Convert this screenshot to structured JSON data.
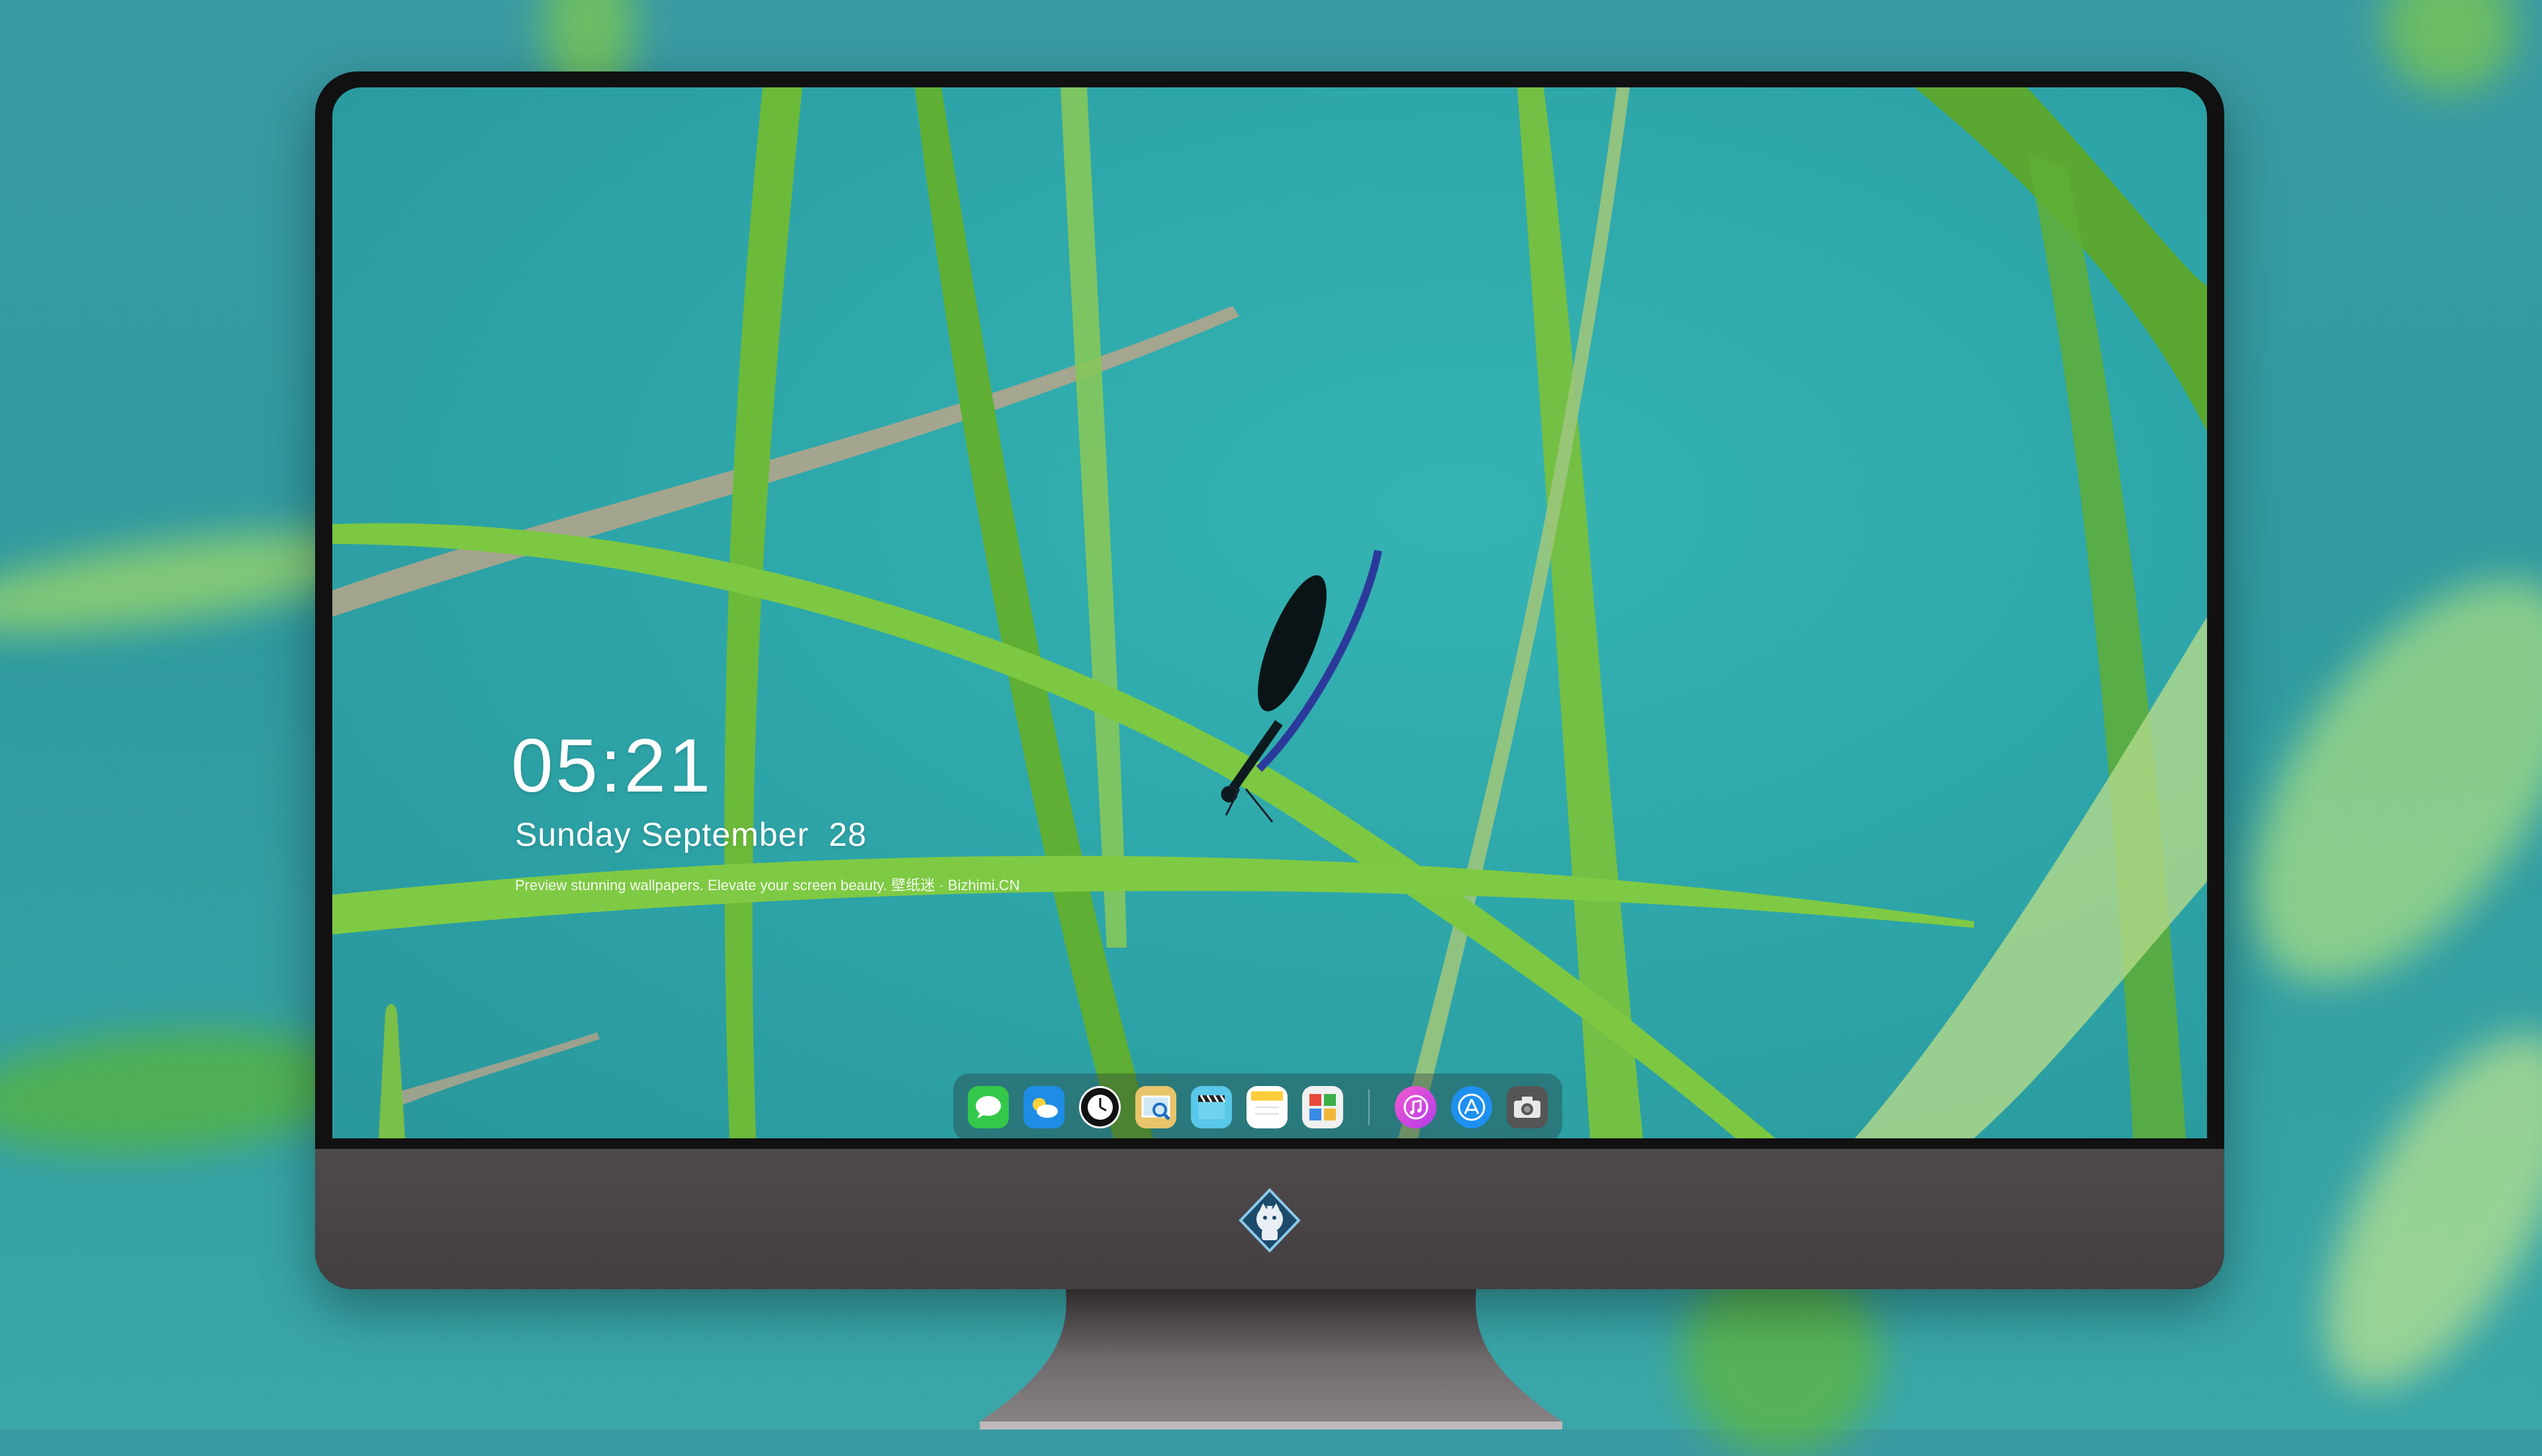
{
  "lockscreen": {
    "time": "05:21",
    "date": "Sunday September  28",
    "tagline": "Preview stunning wallpapers. Elevate your screen beauty. 壁纸迷 · Bizhimi.CN"
  },
  "dock": {
    "apps": [
      {
        "name": "messages-icon"
      },
      {
        "name": "weather-icon"
      },
      {
        "name": "clock-icon"
      },
      {
        "name": "preview-icon"
      },
      {
        "name": "video-clapper-icon"
      },
      {
        "name": "notes-icon"
      },
      {
        "name": "photo-booth-icon"
      },
      {
        "name": "music-icon"
      },
      {
        "name": "app-store-icon"
      },
      {
        "name": "camera-icon"
      }
    ]
  },
  "colors": {
    "screen_teal": "#2ea7aa",
    "grass_green": "#6fc23a",
    "bezel": "#111111",
    "chin": "#4a4648"
  }
}
